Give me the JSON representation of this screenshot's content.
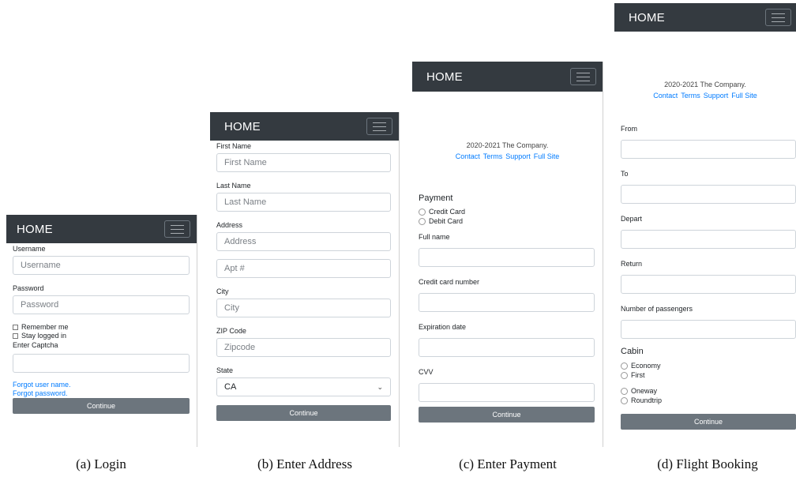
{
  "login": {
    "brand": "HOME",
    "username_label": "Username",
    "username_placeholder": "Username",
    "password_label": "Password",
    "password_placeholder": "Password",
    "remember_label": "Remember me",
    "stay_label": "Stay logged in",
    "captcha_label": "Enter Captcha",
    "forgot_user": "Forgot user name.",
    "forgot_password": "Forgot password.",
    "continue": "Continue",
    "caption": "(a) Login"
  },
  "address": {
    "brand": "HOME",
    "first_label": "First Name",
    "first_placeholder": "First Name",
    "last_label": "Last Name",
    "last_placeholder": "Last Name",
    "address_label": "Address",
    "address_placeholder": "Address",
    "apt_placeholder": "Apt #",
    "city_label": "City",
    "city_placeholder": "City",
    "zip_label": "ZIP Code",
    "zip_placeholder": "Zipcode",
    "state_label": "State",
    "state_value": "CA",
    "continue": "Continue",
    "caption": "(b) Enter Address"
  },
  "payment": {
    "brand": "HOME",
    "footer_text": "2020-2021 The Company.",
    "footer_links": [
      "Contact",
      "Terms",
      "Support",
      "Full Site"
    ],
    "section": "Payment",
    "radio_credit": "Credit Card",
    "radio_debit": "Debit Card",
    "name_label": "Full name",
    "card_label": "Credit card number",
    "exp_label": "Expiration date",
    "cvv_label": "CVV",
    "continue": "Continue",
    "caption": "(c) Enter Payment"
  },
  "flight": {
    "brand": "HOME",
    "footer_text": "2020-2021 The Company.",
    "footer_links": [
      "Contact",
      "Terms",
      "Support",
      "Full Site"
    ],
    "from_label": "From",
    "to_label": "To",
    "depart_label": "Depart",
    "return_label": "Return",
    "passengers_label": "Number of passengers",
    "cabin_title": "Cabin",
    "economy": "Economy",
    "first": "First",
    "oneway": "Oneway",
    "roundtrip": "Roundtrip",
    "continue": "Continue",
    "caption": "(d) Flight Booking"
  }
}
